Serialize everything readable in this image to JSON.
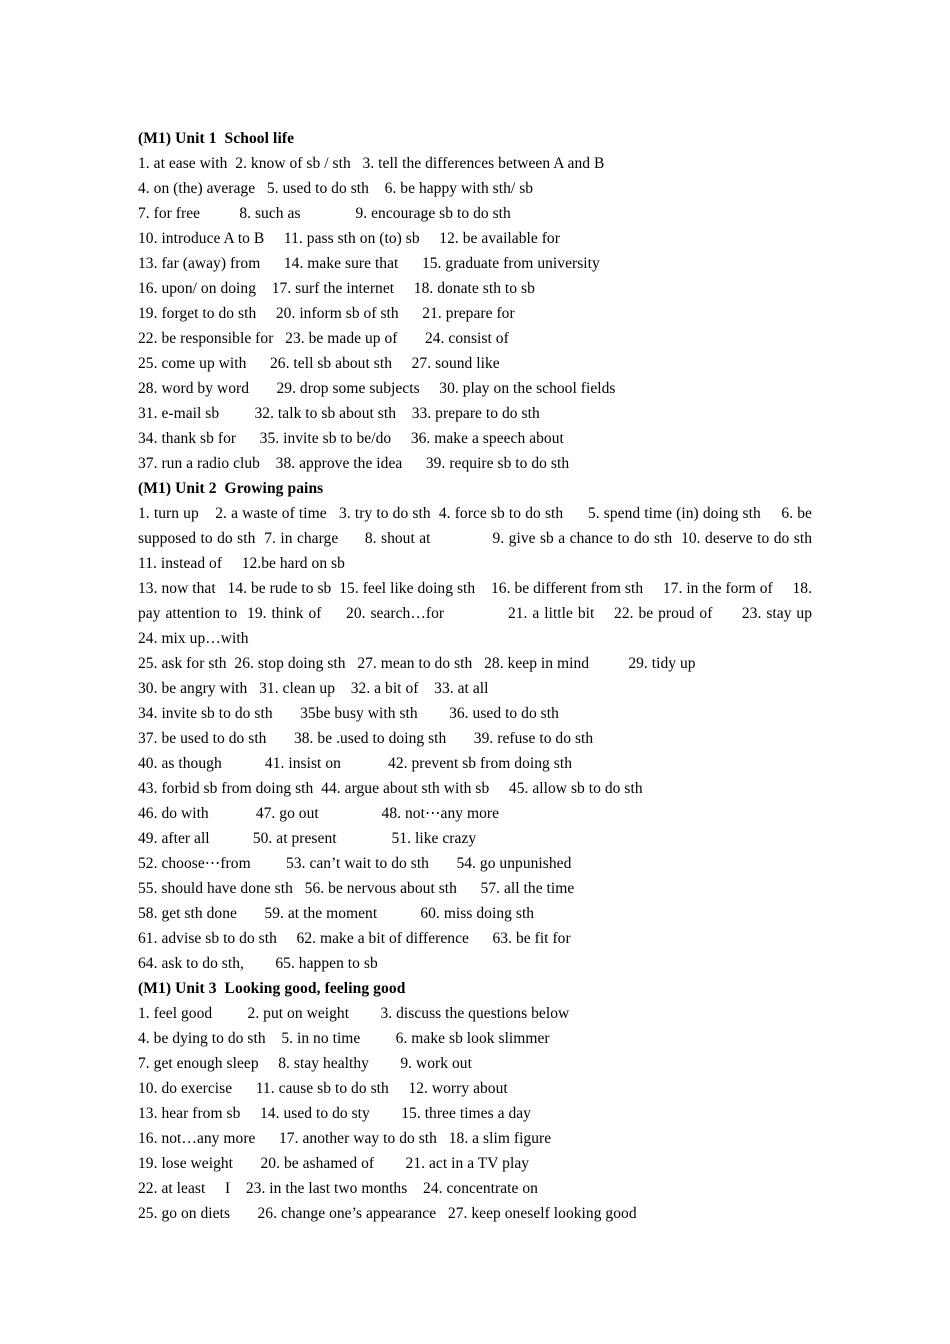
{
  "document": {
    "title": "(M1) Unit 1  School life",
    "page_background": "#ffffff",
    "text_color": "#000000"
  },
  "sections": [
    {
      "id": "unit-1",
      "heading": "(M1) Unit 1  School life",
      "mode": "lines",
      "lines": [
        "1. at ease with  2. know of sb / sth   3. tell the differences between A and B",
        "4. on (the) average   5. used to do sth    6. be happy with sth/ sb",
        "7. for free          8. such as              9. encourage sb to do sth",
        "10. introduce A to B     11. pass sth on (to) sb     12. be available for",
        "13. far (away) from      14. make sure that      15. graduate from university",
        "16. upon/ on doing    17. surf the internet     18. donate sth to sb",
        "19. forget to do sth     20. inform sb of sth      21. prepare for",
        "22. be responsible for   23. be made up of       24. consist of",
        "25. come up with      26. tell sb about sth     27. sound like",
        "28. word by word       29. drop some subjects     30. play on the school fields",
        "31. e-mail sb         32. talk to sb about sth    33. prepare to do sth",
        "34. thank sb for      35. invite sb to be/do     36. make a speech about",
        "37. run a radio club    38. approve the idea      39. require sb to do sth"
      ]
    },
    {
      "id": "unit-2",
      "heading": "(M1) Unit 2  Growing pains",
      "mode": "mixed",
      "blocks": [
        {
          "type": "flow",
          "text": "1. turn up    2. a waste of time   3. try to do sth  4. force sb to do sth      5. spend time (in) doing sth     6. be supposed to do sth  7. in charge      8. shout at              9. give sb a chance to do sth  10. deserve to do sth     11. instead of     12.be hard on sb"
        },
        {
          "type": "flow",
          "text": "13. now that   14. be rude to sb  15. feel like doing sth    16. be different from sth     17. in the form of     18. pay attention to  19. think of     20. search…for             21. a little bit    22. be proud of      23. stay up        24. mix up…with"
        },
        {
          "type": "lines",
          "lines": [
            "25. ask for sth  26. stop doing sth   27. mean to do sth   28. keep in mind          29. tidy up",
            "30. be angry with   31. clean up    32. a bit of    33. at all",
            "34. invite sb to do sth       35be busy with sth        36. used to do sth",
            "37. be used to do sth       38. be .used to doing sth       39. refuse to do sth",
            "40. as though           41. insist on            42. prevent sb from doing sth",
            "43. forbid sb from doing sth  44. argue about sth with sb     45. allow sb to do sth",
            "46. do with            47. go out                48. not⋯any more",
            "49. after all           50. at present              51. like crazy",
            "52. choose⋯from         53. can’t wait to do sth       54. go unpunished",
            "55. should have done sth   56. be nervous about sth      57. all the time",
            "58. get sth done       59. at the moment           60. miss doing sth",
            "61. advise sb to do sth     62. make a bit of difference      63. be fit for",
            "64. ask to do sth,        65. happen to sb"
          ]
        }
      ]
    },
    {
      "id": "unit-3",
      "heading": "(M1) Unit 3  Looking good, feeling good",
      "mode": "lines",
      "lines": [
        "1. feel good         2. put on weight        3. discuss the questions below",
        "4. be dying to do sth    5. in no time         6. make sb look slimmer",
        "7. get enough sleep     8. stay healthy        9. work out",
        "10. do exercise      11. cause sb to do sth     12. worry about",
        "13. hear from sb     14. used to do sty        15. three times a day",
        "16. not…any more      17. another way to do sth   18. a slim figure",
        "19. lose weight       20. be ashamed of        21. act in a TV play",
        "22. at least     I    23. in the last two months    24. concentrate on",
        "25. go on diets       26. change one’s appearance   27. keep oneself looking good"
      ]
    }
  ]
}
